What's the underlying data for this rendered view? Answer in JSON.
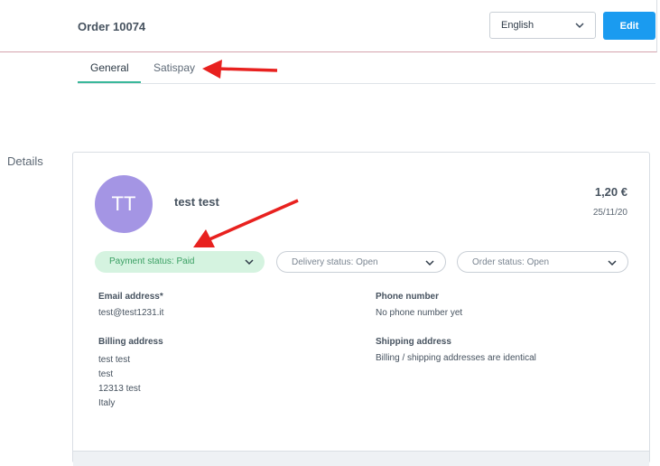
{
  "header": {
    "order_title": "Order 10074",
    "language": {
      "selected": "English"
    },
    "edit_label": "Edit"
  },
  "tabs": [
    {
      "label": "General",
      "active": true
    },
    {
      "label": "Satispay",
      "active": false
    }
  ],
  "section_label": "Details",
  "customer": {
    "initials": "TT",
    "name": "test test",
    "amount": "1,20 €",
    "date": "25/11/20"
  },
  "statuses": {
    "payment": "Payment status: Paid",
    "delivery": "Delivery status: Open",
    "order": "Order status: Open"
  },
  "info": {
    "email_label": "Email address*",
    "email_value": "test@test1231.it",
    "phone_label": "Phone number",
    "phone_value": "No phone number yet",
    "billing_label": "Billing address",
    "billing_lines": [
      "test test",
      "test",
      "12313 test",
      "Italy"
    ],
    "shipping_label": "Shipping address",
    "shipping_value": "Billing / shipping addresses are identical"
  },
  "colors": {
    "accent": "#1a9bf0",
    "tab_underline": "#3ab89a",
    "avatar": "#a495e4",
    "paid_bg": "#d5f3e0",
    "paid_text": "#3a9f63",
    "annotation_arrow": "#e8211f"
  }
}
